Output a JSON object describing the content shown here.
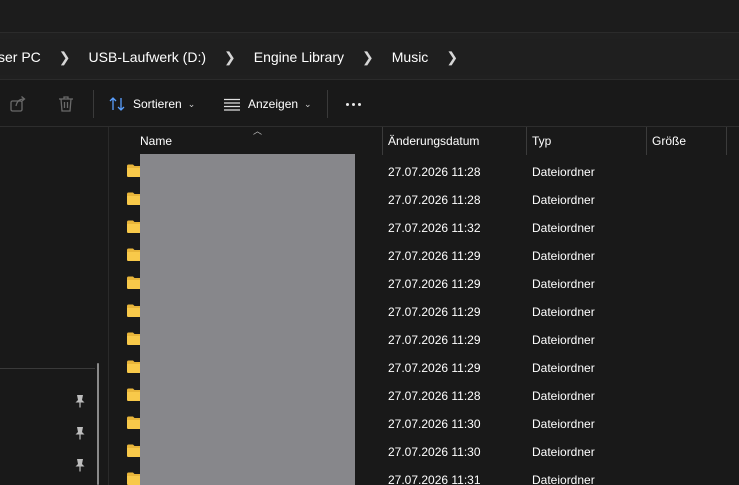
{
  "breadcrumb": {
    "items": [
      "ser PC",
      "USB-Laufwerk (D:)",
      "Engine Library",
      "Music"
    ]
  },
  "toolbar": {
    "sort_label": "Sortieren",
    "view_label": "Anzeigen"
  },
  "columns": {
    "name": "Name",
    "date": "Änderungsdatum",
    "type": "Typ",
    "size": "Größe"
  },
  "rows": [
    {
      "date": "27.07.2026 11:28",
      "type": "Dateiordner"
    },
    {
      "date": "27.07.2026 11:28",
      "type": "Dateiordner"
    },
    {
      "date": "27.07.2026 11:32",
      "type": "Dateiordner"
    },
    {
      "date": "27.07.2026 11:29",
      "type": "Dateiordner"
    },
    {
      "date": "27.07.2026 11:29",
      "type": "Dateiordner"
    },
    {
      "date": "27.07.2026 11:29",
      "type": "Dateiordner"
    },
    {
      "date": "27.07.2026 11:29",
      "type": "Dateiordner"
    },
    {
      "date": "27.07.2026 11:29",
      "type": "Dateiordner"
    },
    {
      "date": "27.07.2026 11:28",
      "type": "Dateiordner"
    },
    {
      "date": "27.07.2026 11:30",
      "type": "Dateiordner"
    },
    {
      "date": "27.07.2026 11:30",
      "type": "Dateiordner"
    },
    {
      "date": "27.07.2026 11:31",
      "type": "Dateiordner"
    }
  ],
  "icons": {
    "share": "share-icon",
    "delete": "delete-icon",
    "sort": "sort-icon",
    "view": "view-icon",
    "more": "more-icon",
    "pin": "pin-icon",
    "folder": "folder-icon"
  },
  "colors": {
    "background": "#191919",
    "folder": "#f8c94a",
    "redaction": "#87878b"
  }
}
